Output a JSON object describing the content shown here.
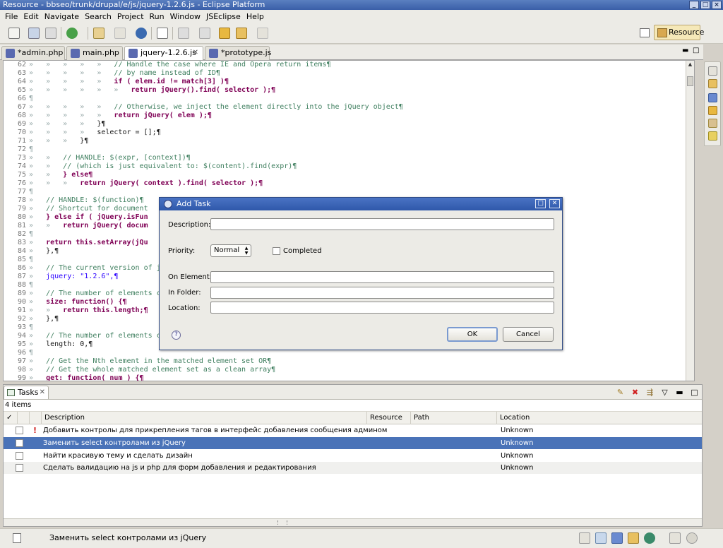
{
  "window": {
    "title": "Resource - bbseo/trunk/drupal/e/js/jquery-1.2.6.js - Eclipse Platform"
  },
  "menu": [
    "File",
    "Edit",
    "Navigate",
    "Search",
    "Project",
    "Run",
    "Window",
    "JSEclipse",
    "Help"
  ],
  "toolbar": {
    "perspective_label": "Resource"
  },
  "editor_tabs": [
    {
      "label": "*admin.php",
      "active": false
    },
    {
      "label": "main.php",
      "active": false
    },
    {
      "label": "jquery-1.2.6.js",
      "active": true
    },
    {
      "label": "*prototype.js",
      "active": false
    }
  ],
  "code_lines": [
    {
      "n": "62",
      "ws": "»   »   »   »   »   ",
      "text": "// Handle the case where IE and Opera return items¶",
      "type": "com"
    },
    {
      "n": "63",
      "ws": "»   »   »   »   »   ",
      "text": "// by name instead of ID¶",
      "type": "com"
    },
    {
      "n": "64",
      "ws": "»   »   »   »   »   ",
      "text": "if ( elem.id != match[3] )¶",
      "type": "kw"
    },
    {
      "n": "65",
      "ws": "»   »   »   »   »   »   ",
      "text": "return jQuery().find( selector );¶",
      "type": "kw"
    },
    {
      "n": "66",
      "ws": "",
      "text": "¶",
      "type": "ws"
    },
    {
      "n": "67",
      "ws": "»   »   »   »   »   ",
      "text": "// Otherwise, we inject the element directly into the jQuery object¶",
      "type": "com"
    },
    {
      "n": "68",
      "ws": "»   »   »   »   »   ",
      "text": "return jQuery( elem );¶",
      "type": "kw"
    },
    {
      "n": "69",
      "ws": "»   »   »   »   ",
      "text": "}¶",
      "type": "tx"
    },
    {
      "n": "70",
      "ws": "»   »   »   »   ",
      "text": "selector = [];¶",
      "type": "tx"
    },
    {
      "n": "71",
      "ws": "»   »   »   ",
      "text": "}¶",
      "type": "tx"
    },
    {
      "n": "72",
      "ws": "",
      "text": "¶",
      "type": "ws"
    },
    {
      "n": "73",
      "ws": "»   »   ",
      "text": "// HANDLE: $(expr, [context])¶",
      "type": "com"
    },
    {
      "n": "74",
      "ws": "»   »   ",
      "text": "// (which is just equivalent to: $(content).find(expr)¶",
      "type": "com"
    },
    {
      "n": "75",
      "ws": "»   »   ",
      "text": "} else¶",
      "type": "kw"
    },
    {
      "n": "76",
      "ws": "»   »   »   ",
      "text": "return jQuery( context ).find( selector );¶",
      "type": "kw"
    },
    {
      "n": "77",
      "ws": "",
      "text": "¶",
      "type": "ws"
    },
    {
      "n": "78",
      "ws": "»   ",
      "text": "// HANDLE: $(function)¶",
      "type": "com"
    },
    {
      "n": "79",
      "ws": "»   ",
      "text": "// Shortcut for document",
      "type": "com"
    },
    {
      "n": "80",
      "ws": "»   ",
      "text": "} else if ( jQuery.isFun",
      "type": "kw"
    },
    {
      "n": "81",
      "ws": "»   »   ",
      "text": "return jQuery( docum",
      "type": "kw"
    },
    {
      "n": "82",
      "ws": "",
      "text": "¶",
      "type": "ws"
    },
    {
      "n": "83",
      "ws": "»   ",
      "text": "return this.setArray(jQu",
      "type": "kw"
    },
    {
      "n": "84",
      "ws": "»   ",
      "text": "},¶",
      "type": "tx"
    },
    {
      "n": "85",
      "ws": "",
      "text": "¶",
      "type": "ws"
    },
    {
      "n": "86",
      "ws": "»   ",
      "text": "// The current version of jQ",
      "type": "com"
    },
    {
      "n": "87",
      "ws": "»   ",
      "text": "jquery: \"1.2.6\",¶",
      "type": "str"
    },
    {
      "n": "88",
      "ws": "",
      "text": "¶",
      "type": "ws"
    },
    {
      "n": "89",
      "ws": "»   ",
      "text": "// The number of elements co",
      "type": "com"
    },
    {
      "n": "90",
      "ws": "»   ",
      "text": "size: function() {¶",
      "type": "kw"
    },
    {
      "n": "91",
      "ws": "»   »   ",
      "text": "return this.length;¶",
      "type": "kw"
    },
    {
      "n": "92",
      "ws": "»   ",
      "text": "},¶",
      "type": "tx"
    },
    {
      "n": "93",
      "ws": "",
      "text": "¶",
      "type": "ws"
    },
    {
      "n": "94",
      "ws": "»   ",
      "text": "// The number of elements co",
      "type": "com"
    },
    {
      "n": "95",
      "ws": "»   ",
      "text": "length: 0,¶",
      "type": "tx"
    },
    {
      "n": "96",
      "ws": "",
      "text": "¶",
      "type": "ws"
    },
    {
      "n": "97",
      "ws": "»   ",
      "text": "// Get the Nth element in the matched element set OR¶",
      "type": "com"
    },
    {
      "n": "98",
      "ws": "»   ",
      "text": "// Get the whole matched element set as a clean array¶",
      "type": "com"
    },
    {
      "n": "99",
      "ws": "»   ",
      "text": "get: function( num ) {¶",
      "type": "kw"
    }
  ],
  "dialog": {
    "title": "Add Task",
    "description_label": "Description:",
    "description_value": "",
    "priority_label": "Priority:",
    "priority_value": "Normal",
    "completed_label": "Completed",
    "on_element_label": "On Element:",
    "on_element_value": "",
    "in_folder_label": "In Folder:",
    "in_folder_value": "",
    "location_label": "Location:",
    "location_value": "",
    "ok_label": "OK",
    "cancel_label": "Cancel",
    "help_glyph": "?"
  },
  "tasks": {
    "tab_label": "Tasks",
    "count_label": "4 items",
    "columns": {
      "check": "✓",
      "description": "Description",
      "resource": "Resource",
      "path": "Path",
      "location": "Location"
    },
    "rows": [
      {
        "priority": "!",
        "description": "Добавить контролы для прикрепления тагов в интерфейс добавления сообщения админом",
        "location": "Unknown"
      },
      {
        "priority": "",
        "description": "Заменить select контролами из jQuery",
        "location": "Unknown"
      },
      {
        "priority": "",
        "description": "Найти красивую тему и сделать дизайн",
        "location": "Unknown"
      },
      {
        "priority": "",
        "description": "Сделать валидацию на js и php для форм добавления и редактирования",
        "location": "Unknown"
      }
    ]
  },
  "status": {
    "text": "Заменить select контролами из jQuery"
  },
  "colors": {
    "title_bar": "#3a5fa8",
    "selection": "#4a73b8",
    "comment": "#3f7f5f",
    "keyword": "#7f0055",
    "string": "#2a00ff"
  }
}
